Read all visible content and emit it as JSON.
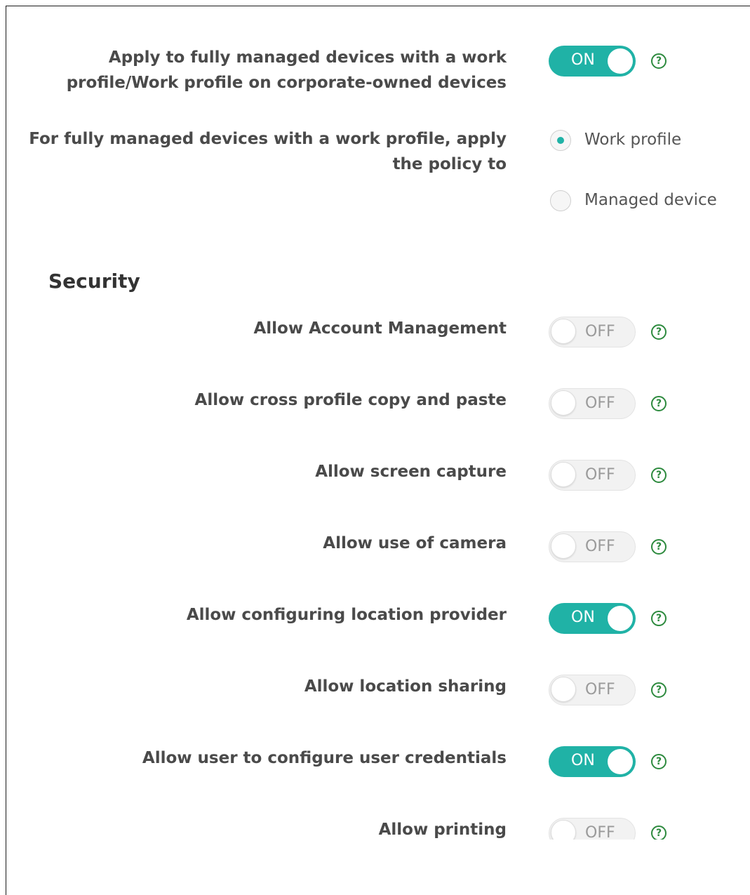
{
  "top_settings": {
    "apply_fully_managed": {
      "label_line1": "Apply to fully managed devices with a work",
      "label_line2": "profile/Work profile on corporate-owned devices",
      "state": "ON",
      "help": "?"
    },
    "apply_policy_to": {
      "label_line1": "For fully managed devices with a work profile, apply",
      "label_line2": "the policy to",
      "options": [
        {
          "label": "Work profile",
          "selected": true
        },
        {
          "label": "Managed device",
          "selected": false
        }
      ]
    }
  },
  "security": {
    "title": "Security",
    "settings": [
      {
        "label": "Allow Account Management",
        "state": "OFF",
        "help": "?"
      },
      {
        "label": "Allow cross profile copy and paste",
        "state": "OFF",
        "help": "?"
      },
      {
        "label": "Allow screen capture",
        "state": "OFF",
        "help": "?"
      },
      {
        "label": "Allow use of camera",
        "state": "OFF",
        "help": "?"
      },
      {
        "label": "Allow configuring location provider",
        "state": "ON",
        "help": "?"
      },
      {
        "label": "Allow location sharing",
        "state": "OFF",
        "help": "?"
      },
      {
        "label": "Allow user to configure user credentials",
        "state": "ON",
        "help": "?"
      },
      {
        "label": "Allow printing",
        "state": "OFF",
        "help": "?"
      }
    ]
  },
  "colors": {
    "toggle_on": "#20b2a6",
    "toggle_off": "#f2f2f2",
    "help_icon": "#2d8a3e",
    "radio_selected": "#20b2a6"
  }
}
